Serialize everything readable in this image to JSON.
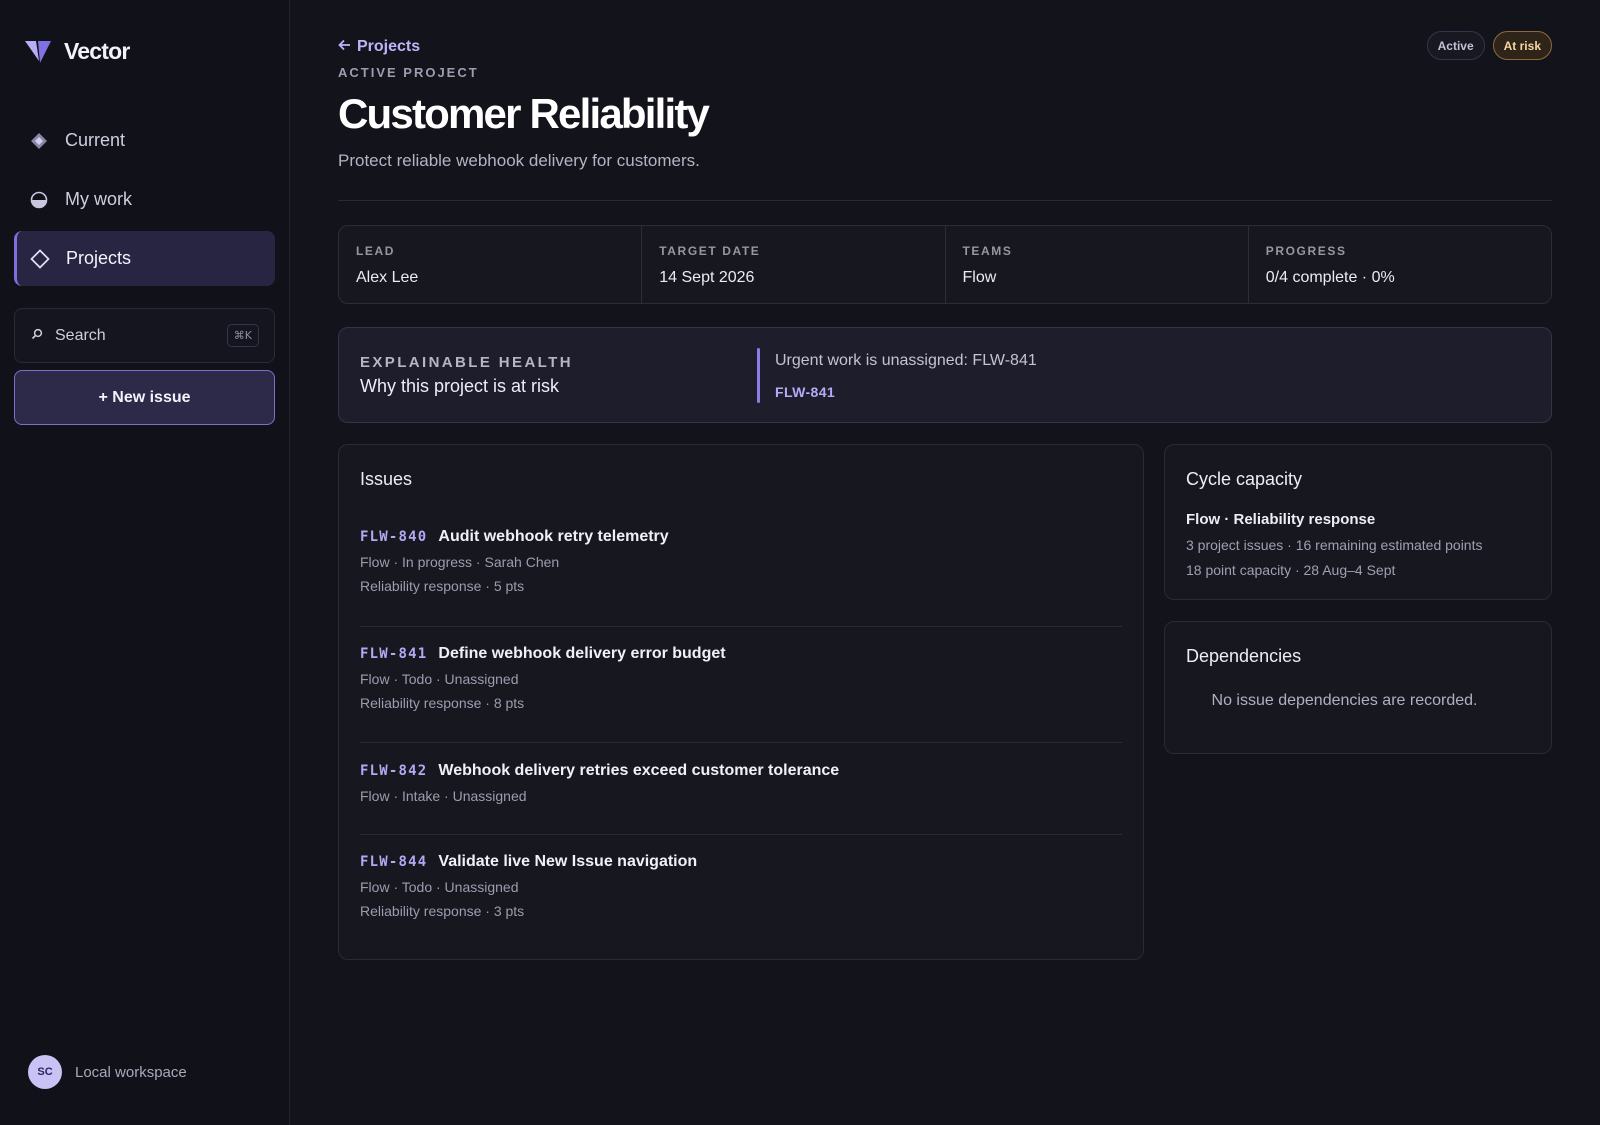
{
  "app": {
    "name": "Vector"
  },
  "sidebar": {
    "items": [
      {
        "label": "Current",
        "icon": "diamond-filled-icon"
      },
      {
        "label": "My work",
        "icon": "half-circle-icon"
      },
      {
        "label": "Projects",
        "icon": "diamond-outline-icon",
        "active": true
      }
    ],
    "search": {
      "label": "Search",
      "shortcut": "⌘K"
    },
    "new_issue": "+ New issue",
    "workspace": {
      "avatar": "SC",
      "label": "Local workspace"
    }
  },
  "header": {
    "back": "Projects",
    "eyebrow": "ACTIVE PROJECT",
    "title": "Customer Reliability",
    "description": "Protect reliable webhook delivery for customers.",
    "badges": [
      "Active",
      "At risk"
    ]
  },
  "meta": [
    {
      "label": "LEAD",
      "value": "Alex Lee"
    },
    {
      "label": "TARGET DATE",
      "value": "14 Sept 2026"
    },
    {
      "label": "TEAMS",
      "value": "Flow"
    },
    {
      "label": "PROGRESS",
      "value": "0/4 complete · 0%"
    }
  ],
  "health": {
    "eyebrow": "EXPLAINABLE HEALTH",
    "title": "Why this project is at risk",
    "reason": "Urgent work is unassigned: FLW-841",
    "link": "FLW-841"
  },
  "issues": {
    "title": "Issues",
    "items": [
      {
        "id": "FLW-840",
        "title": "Audit webhook retry telemetry",
        "meta": "Flow · In progress · Sarah Chen",
        "meta2": "Reliability response · 5 pts"
      },
      {
        "id": "FLW-841",
        "title": "Define webhook delivery error budget",
        "meta": "Flow · Todo · Unassigned",
        "meta2": "Reliability response · 8 pts"
      },
      {
        "id": "FLW-842",
        "title": "Webhook delivery retries exceed customer tolerance",
        "meta": "Flow · Intake · Unassigned",
        "meta2": ""
      },
      {
        "id": "FLW-844",
        "title": "Validate live New Issue navigation",
        "meta": "Flow · Todo · Unassigned",
        "meta2": "Reliability response · 3 pts"
      }
    ]
  },
  "capacity": {
    "title": "Cycle capacity",
    "subtitle": "Flow · Reliability response",
    "line1": "3 project issues · 16 remaining estimated points",
    "line2": "18 point capacity · 28 Aug–4 Sept"
  },
  "dependencies": {
    "title": "Dependencies",
    "empty": "No issue dependencies are recorded."
  },
  "colors": {
    "accent": "#8a7ee6",
    "risk": "#f5d6a5",
    "background": "#13131c"
  }
}
